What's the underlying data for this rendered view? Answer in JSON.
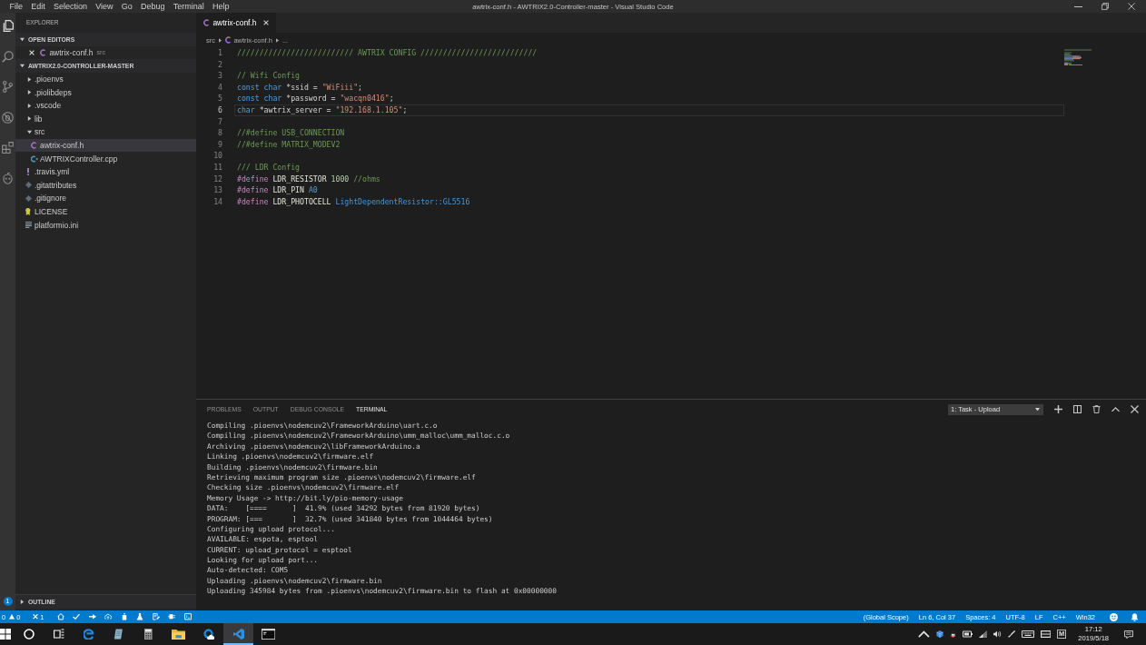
{
  "window": {
    "title": "awtrix-conf.h - AWTRIX2.0-Controller-master - Visual Studio Code",
    "menu": [
      "File",
      "Edit",
      "Selection",
      "View",
      "Go",
      "Debug",
      "Terminal",
      "Help"
    ]
  },
  "activity_bar": {
    "items": [
      {
        "kind": "explorer",
        "selected": true
      },
      {
        "kind": "search",
        "selected": false
      },
      {
        "kind": "source-control",
        "selected": false
      },
      {
        "kind": "debug",
        "selected": false
      },
      {
        "kind": "extensions",
        "selected": false
      },
      {
        "kind": "platformio",
        "selected": false
      }
    ],
    "badge": "1"
  },
  "sidebar": {
    "title": "EXPLORER",
    "open_editors": {
      "label": "OPEN EDITORS",
      "expanded": true,
      "items": [
        {
          "name": "awtrix-conf.h",
          "kind": "c-header",
          "description": "src"
        }
      ]
    },
    "project": {
      "label": "AWTRIX2.0-CONTROLLER-MASTER",
      "expanded": true,
      "items": [
        {
          "name": ".pioenvs",
          "kind": "folder",
          "expanded": false,
          "selected": false
        },
        {
          "name": ".piolibdeps",
          "kind": "folder",
          "expanded": false,
          "selected": false
        },
        {
          "name": ".vscode",
          "kind": "folder",
          "expanded": false,
          "selected": false
        },
        {
          "name": "lib",
          "kind": "folder",
          "expanded": false,
          "selected": false
        },
        {
          "name": "src",
          "kind": "folder",
          "expanded": true,
          "selected": false,
          "children": [
            {
              "name": "awtrix-conf.h",
              "kind": "c-header",
              "selected": true
            },
            {
              "name": "AWTRIXController.cpp",
              "kind": "cpp",
              "selected": false
            }
          ]
        },
        {
          "name": ".travis.yml",
          "kind": "yaml",
          "selected": false
        },
        {
          "name": ".gitattributes",
          "kind": "git",
          "selected": false
        },
        {
          "name": ".gitignore",
          "kind": "git",
          "selected": false
        },
        {
          "name": "LICENSE",
          "kind": "license",
          "selected": false
        },
        {
          "name": "platformio.ini",
          "kind": "config",
          "selected": false
        }
      ]
    },
    "outline": {
      "label": "OUTLINE",
      "expanded": false
    }
  },
  "editor": {
    "tabs": [
      {
        "label": "awtrix-conf.h",
        "kind": "c-header",
        "selected": true
      }
    ],
    "breadcrumbs": [
      {
        "label": "src",
        "kind": "folder"
      },
      {
        "label": "awtrix-conf.h",
        "kind": "c-header"
      },
      {
        "label": "...",
        "kind": "more"
      }
    ],
    "lines": [
      {
        "number": "1",
        "selected": false,
        "tokens": [
          {
            "kind": "comment",
            "text": "////////////////////////// AWTRIX CONFIG //////////////////////////"
          }
        ]
      },
      {
        "number": "2",
        "selected": false
      },
      {
        "number": "3",
        "selected": false,
        "tokens": [
          {
            "kind": "comment",
            "text": "// Wifi Config"
          }
        ]
      },
      {
        "number": "4",
        "selected": false,
        "tokens": [
          {
            "kind": "keyword",
            "text": "const char"
          },
          {
            "kind": "plain",
            "text": " *ssid = "
          },
          {
            "kind": "string",
            "text": "\"WiFiii\""
          },
          {
            "kind": "plain",
            "text": ";"
          }
        ]
      },
      {
        "number": "5",
        "selected": false,
        "tokens": [
          {
            "kind": "keyword",
            "text": "const char"
          },
          {
            "kind": "plain",
            "text": " *password = "
          },
          {
            "kind": "string",
            "text": "\"wacqn0416\""
          },
          {
            "kind": "plain",
            "text": ";"
          }
        ]
      },
      {
        "number": "6",
        "selected": true,
        "tokens": [
          {
            "kind": "keyword",
            "text": "char"
          },
          {
            "kind": "plain",
            "text": " *awtrix_server = "
          },
          {
            "kind": "string",
            "text": "\"192.168.1.105\""
          },
          {
            "kind": "plain",
            "text": ";"
          }
        ]
      },
      {
        "number": "7",
        "selected": false
      },
      {
        "number": "8",
        "selected": false,
        "tokens": [
          {
            "kind": "comment",
            "text": "//#define USB_CONNECTION"
          }
        ]
      },
      {
        "number": "9",
        "selected": false,
        "tokens": [
          {
            "kind": "comment",
            "text": "//#define MATRIX_MODEV2"
          }
        ]
      },
      {
        "number": "10",
        "selected": false
      },
      {
        "number": "11",
        "selected": false,
        "tokens": [
          {
            "kind": "comment",
            "text": "/// LDR Config"
          }
        ]
      },
      {
        "number": "12",
        "selected": false,
        "tokens": [
          {
            "kind": "directive",
            "text": "#define"
          },
          {
            "kind": "macro",
            "text": " LDR_RESISTOR "
          },
          {
            "kind": "number",
            "text": "1000"
          },
          {
            "kind": "comment",
            "text": " //ohms"
          }
        ]
      },
      {
        "number": "13",
        "selected": false,
        "tokens": [
          {
            "kind": "directive",
            "text": "#define"
          },
          {
            "kind": "macro",
            "text": " LDR_PIN "
          },
          {
            "kind": "constant",
            "text": "A0"
          }
        ]
      },
      {
        "number": "14",
        "selected": false,
        "tokens": [
          {
            "kind": "directive",
            "text": "#define"
          },
          {
            "kind": "macro",
            "text": " LDR_PHOTOCELL "
          },
          {
            "kind": "type",
            "text": "LightDependentResistor::GL5516"
          }
        ]
      }
    ]
  },
  "panel": {
    "tabs": [
      {
        "label": "PROBLEMS",
        "selected": false
      },
      {
        "label": "OUTPUT",
        "selected": false
      },
      {
        "label": "DEBUG CONSOLE",
        "selected": false
      },
      {
        "label": "TERMINAL",
        "selected": true
      }
    ],
    "task_select": "1: Task - Upload",
    "terminal_lines": [
      "Compiling .pioenvs\\nodemcuv2\\FrameworkArduino\\uart.c.o",
      "Compiling .pioenvs\\nodemcuv2\\FrameworkArduino\\umm_malloc\\umm_malloc.c.o",
      "Archiving .pioenvs\\nodemcuv2\\libFrameworkArduino.a",
      "Linking .pioenvs\\nodemcuv2\\firmware.elf",
      "Building .pioenvs\\nodemcuv2\\firmware.bin",
      "Retrieving maximum program size .pioenvs\\nodemcuv2\\firmware.elf",
      "Checking size .pioenvs\\nodemcuv2\\firmware.elf",
      "Memory Usage -> http://bit.ly/pio-memory-usage",
      "DATA:    [====      ]  41.9% (used 34292 bytes from 81920 bytes)",
      "PROGRAM: [===       ]  32.7% (used 341840 bytes from 1044464 bytes)",
      "Configuring upload protocol...",
      "AVAILABLE: espota, esptool",
      "CURRENT: upload_protocol = esptool",
      "Looking for upload port...",
      "Auto-detected: COM5",
      "Uploading .pioenvs\\nodemcuv2\\firmware.bin",
      "Uploading 345984 bytes from .pioenvs\\nodemcuv2\\firmware.bin to flash at 0x00000000"
    ]
  },
  "status_bar": {
    "left": [
      {
        "kind": "errors",
        "text": "0"
      },
      {
        "kind": "warnings",
        "text": "0"
      },
      {
        "kind": "other",
        "text": "1"
      }
    ],
    "right": [
      "(Global Scope)",
      "Ln 6, Col 37",
      "Spaces: 4",
      "UTF-8",
      "LF",
      "C++",
      "Win32"
    ]
  },
  "taskbar": {
    "apps": [
      {
        "kind": "start",
        "selected": false
      },
      {
        "kind": "search",
        "selected": false
      },
      {
        "kind": "task-view",
        "selected": false
      },
      {
        "kind": "browser",
        "selected": false
      },
      {
        "kind": "notes",
        "selected": false
      },
      {
        "kind": "calculator",
        "selected": false
      },
      {
        "kind": "files",
        "selected": false
      },
      {
        "kind": "cloud",
        "selected": false
      },
      {
        "kind": "editor",
        "selected": true
      },
      {
        "kind": "console",
        "selected": false
      }
    ],
    "input_indicator": "M",
    "time": "17:12",
    "date": "2019/5/18"
  }
}
